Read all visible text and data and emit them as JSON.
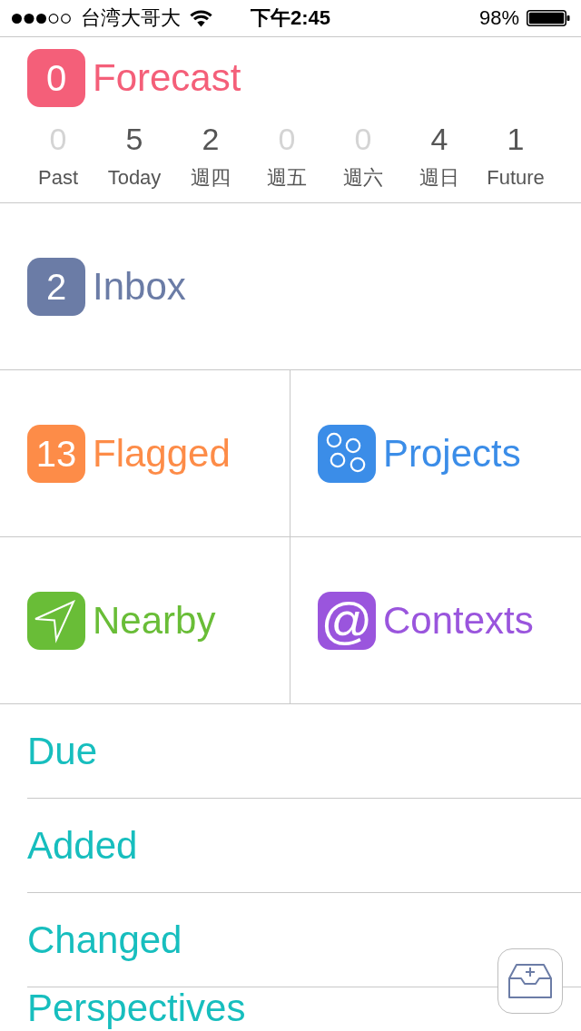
{
  "status_bar": {
    "carrier": "台湾大哥大",
    "time": "下午2:45",
    "battery": "98%"
  },
  "forecast": {
    "count": "0",
    "title": "Forecast",
    "color": "#f45f79",
    "days": [
      {
        "count": "0",
        "label": "Past",
        "dimmed": true
      },
      {
        "count": "5",
        "label": "Today",
        "dimmed": false
      },
      {
        "count": "2",
        "label": "週四",
        "dimmed": false
      },
      {
        "count": "0",
        "label": "週五",
        "dimmed": true
      },
      {
        "count": "0",
        "label": "週六",
        "dimmed": true
      },
      {
        "count": "4",
        "label": "週日",
        "dimmed": false
      },
      {
        "count": "1",
        "label": "Future",
        "dimmed": false
      }
    ]
  },
  "inbox": {
    "count": "2",
    "title": "Inbox",
    "color": "#6b7ca6"
  },
  "grid": [
    {
      "kind": "count",
      "count": "13",
      "title": "Flagged",
      "color": "#fd8c48"
    },
    {
      "kind": "projects",
      "title": "Projects",
      "color": "#3b8de8"
    },
    {
      "kind": "nearby",
      "title": "Nearby",
      "color": "#69bd37"
    },
    {
      "kind": "symbol",
      "symbol": "@",
      "title": "Contexts",
      "color": "#9a55dd"
    }
  ],
  "list": [
    "Due",
    "Added",
    "Changed",
    "Perspectives"
  ]
}
